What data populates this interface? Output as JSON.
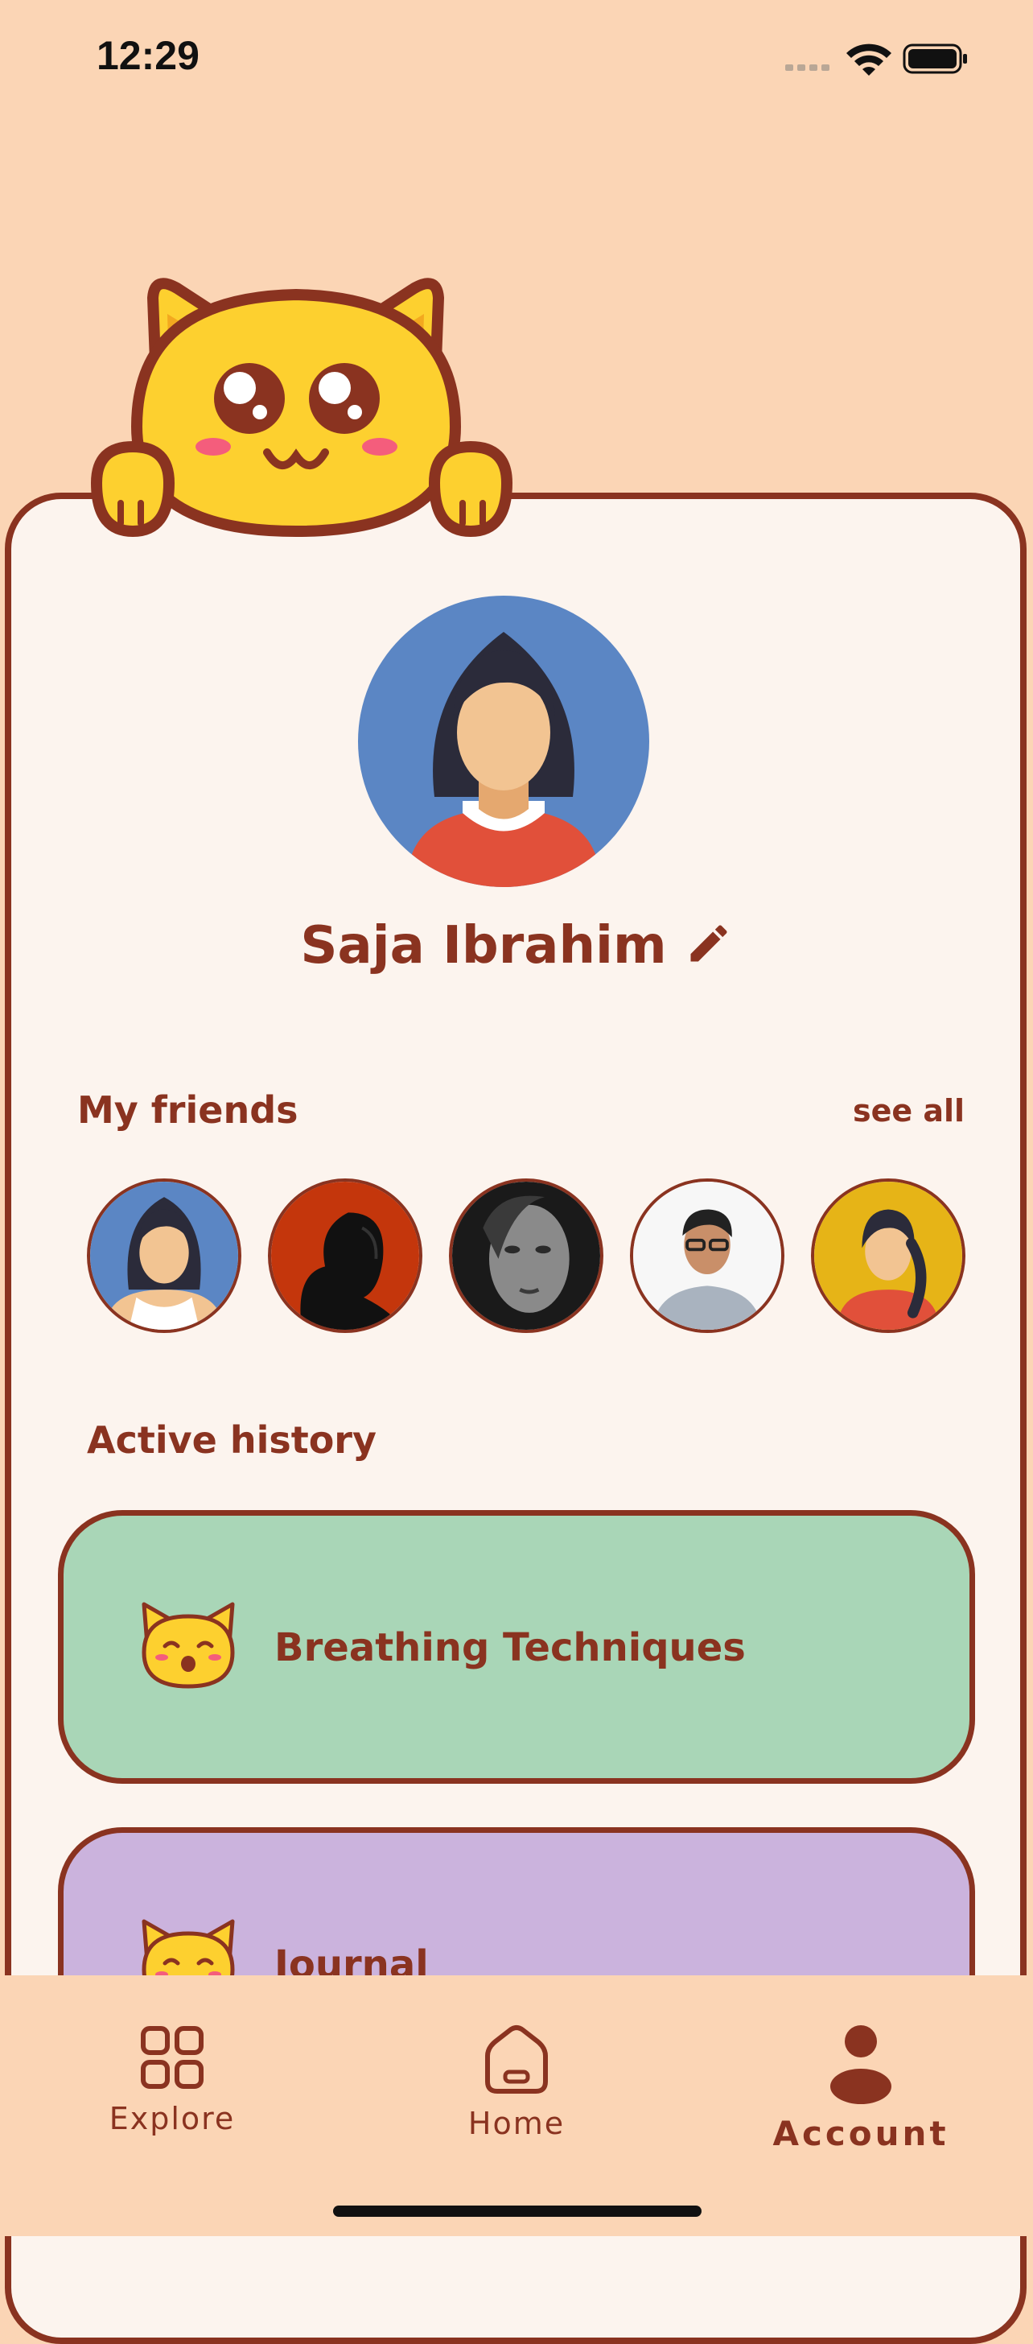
{
  "status": {
    "time": "12:29"
  },
  "profile": {
    "name": "Saja Ibrahim"
  },
  "friends": {
    "title": "My friends",
    "see_all": "see all"
  },
  "history": {
    "title": "Active history",
    "items": [
      {
        "label": "Breathing Techniques",
        "color": "#a9d6b7"
      },
      {
        "label": "Journal",
        "color": "#cbb3dd"
      }
    ]
  },
  "tabs": [
    {
      "label": "Explore",
      "icon": "grid-icon",
      "active": false
    },
    {
      "label": "Home",
      "icon": "home-icon",
      "active": false
    },
    {
      "label": "Account",
      "icon": "person-icon",
      "active": true
    }
  ],
  "colors": {
    "background": "#fbd5b5",
    "card": "#fcf4ee",
    "accent": "#8a3320",
    "mascot": "#fdd02f"
  }
}
